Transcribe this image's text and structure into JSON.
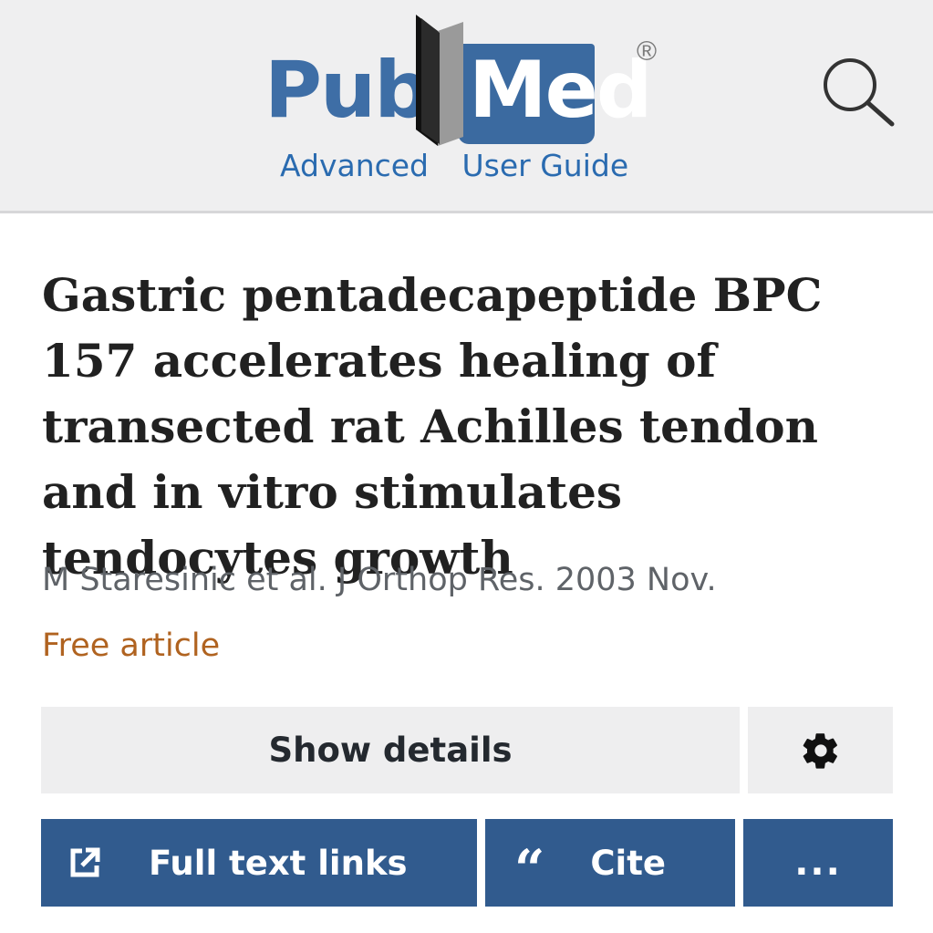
{
  "header": {
    "logo": {
      "part1": "Pub",
      "part2": "Med",
      "registered": "®"
    },
    "links": [
      "Advanced",
      "User Guide"
    ],
    "search_icon": "search-icon"
  },
  "article": {
    "title": "Gastric pentadecapeptide BPC 157 accelerates healing of transected rat Achilles tendon and in vitro stimulates tendocytes growth",
    "citation": "M Staresinic et al. J Orthop Res. 2003 Nov.",
    "free_label": "Free article"
  },
  "actions": {
    "show_details": "Show details",
    "settings_icon": "gear-icon",
    "full_text_icon": "external-link-icon",
    "full_text": "Full text links",
    "cite_glyph": "“",
    "cite": "Cite",
    "more": "..."
  },
  "colors": {
    "brand_blue": "#3e6ea6",
    "link_blue": "#2a6bb0",
    "button_blue": "#315b8e",
    "free_orange": "#b06320",
    "header_bg": "#efeff0"
  }
}
